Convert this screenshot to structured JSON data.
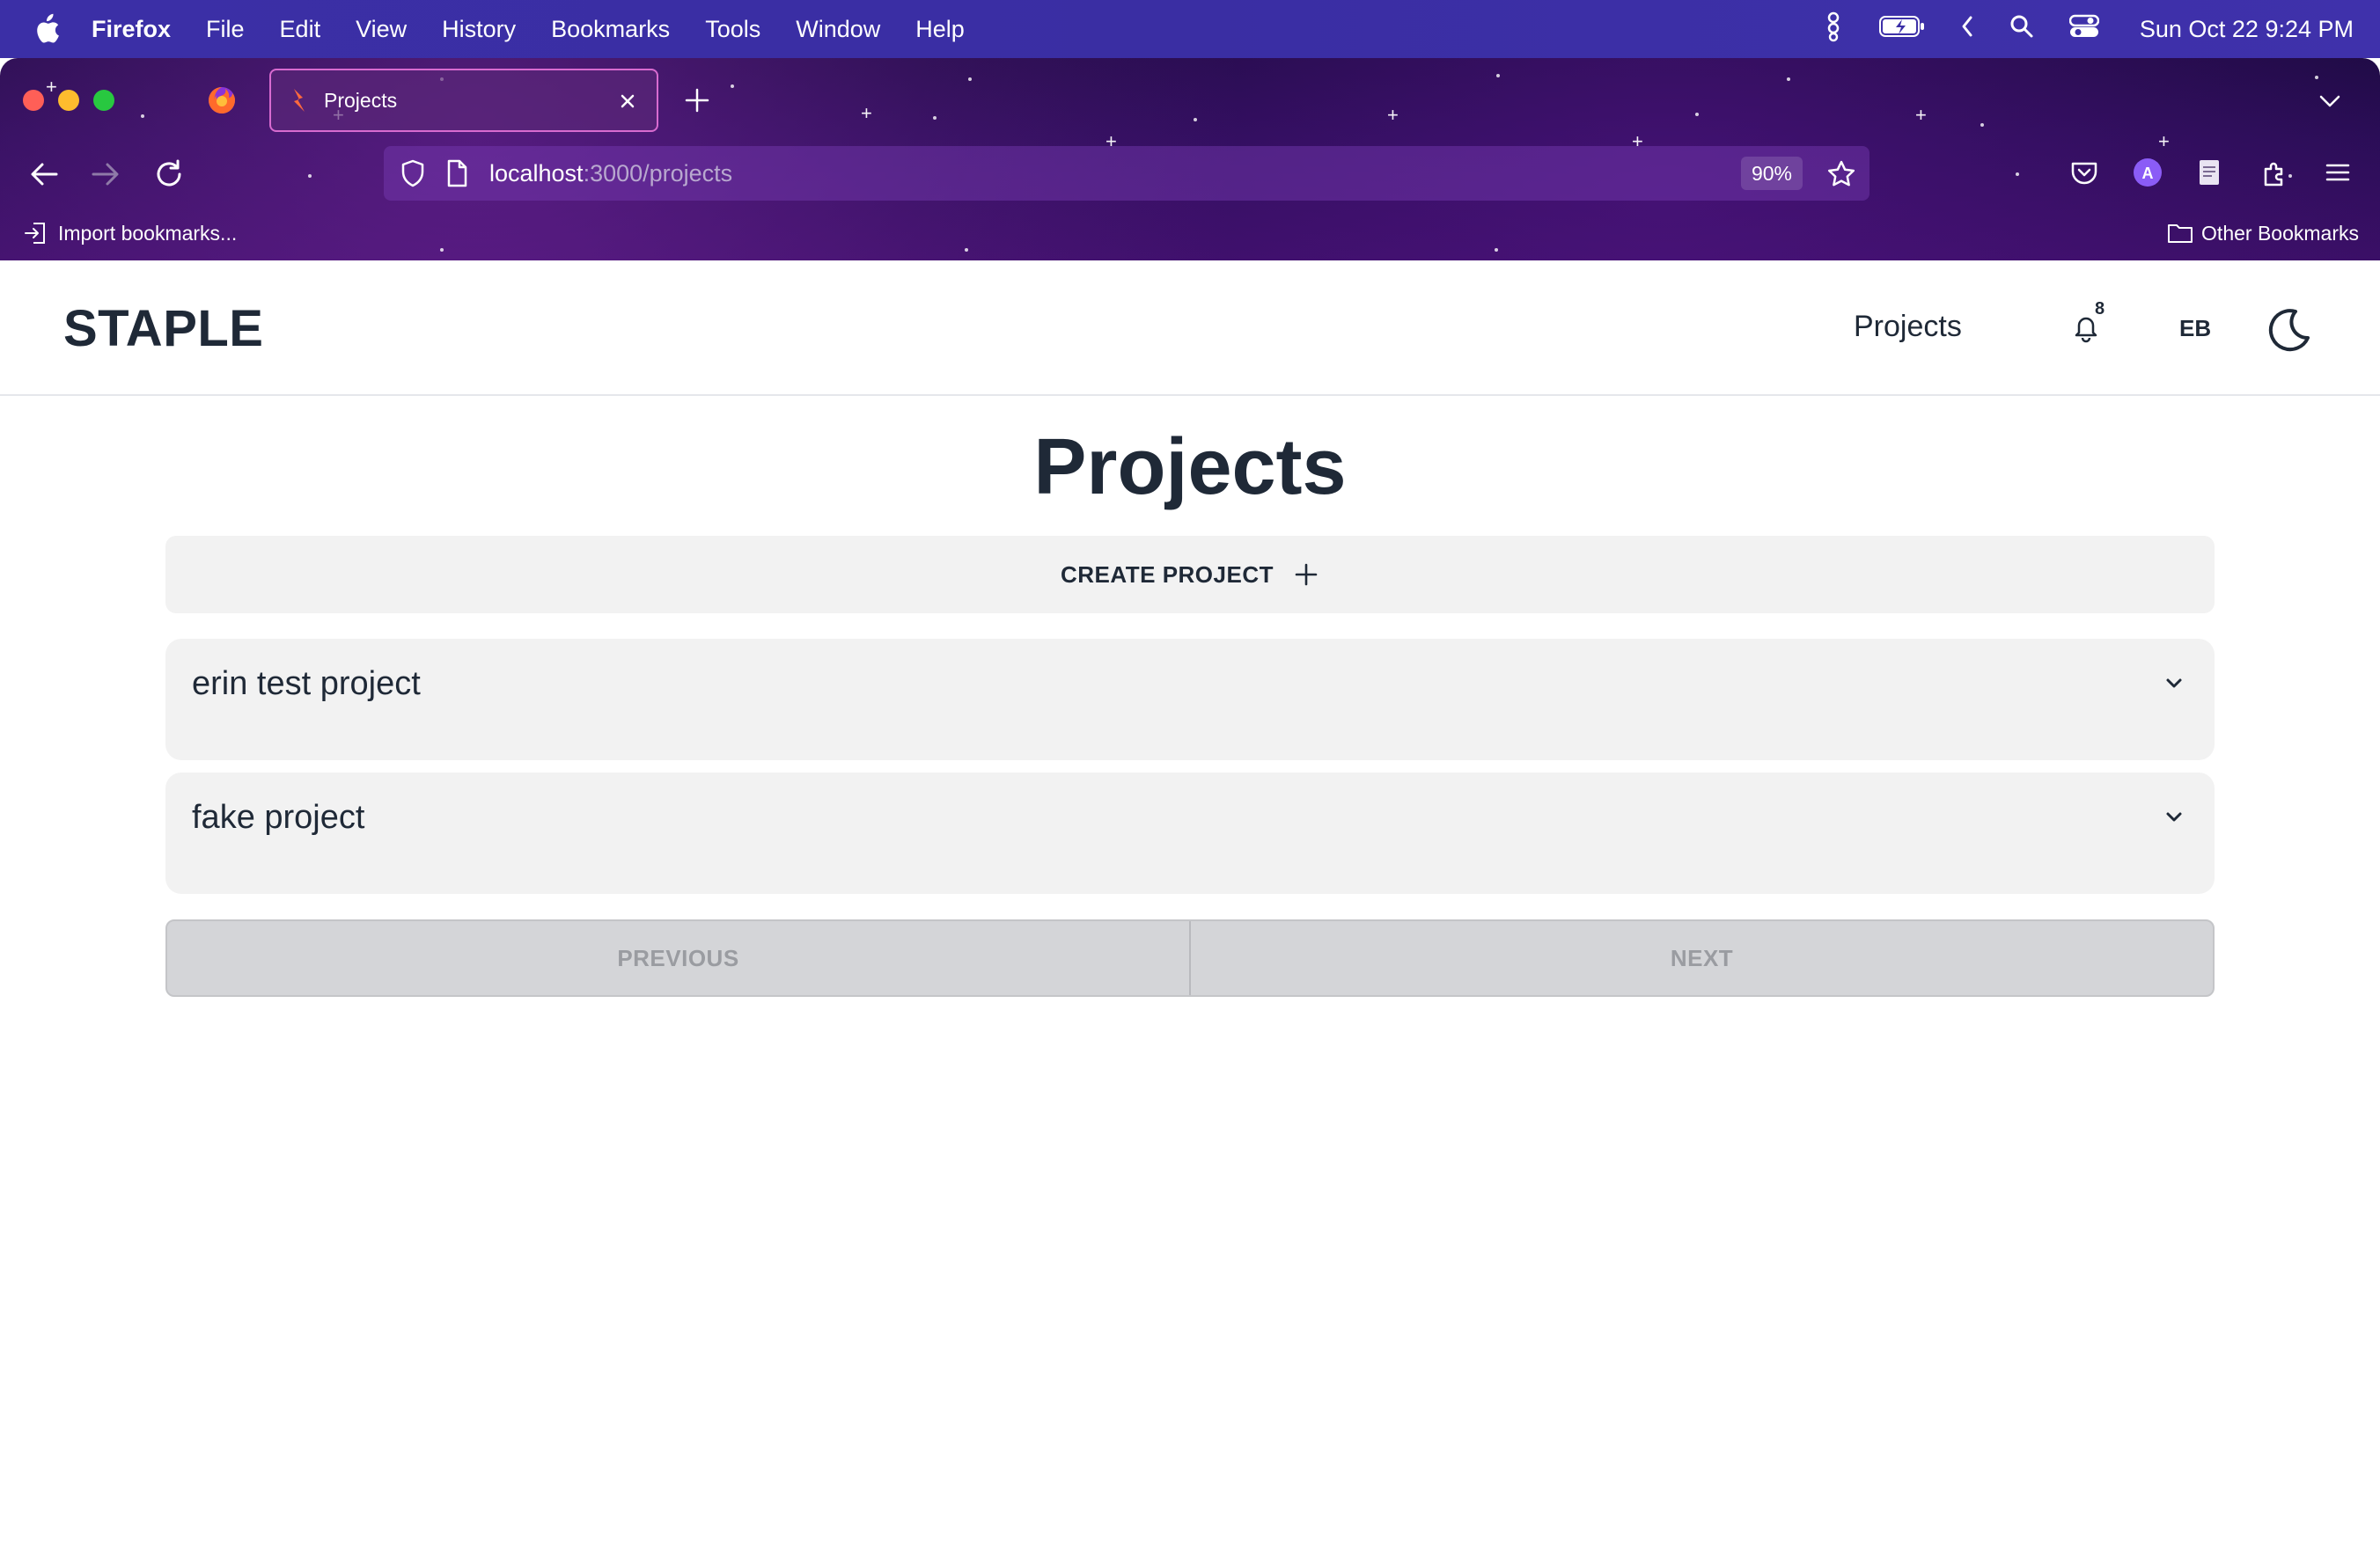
{
  "menubar": {
    "app_name": "Firefox",
    "items": [
      "File",
      "Edit",
      "View",
      "History",
      "Bookmarks",
      "Tools",
      "Window",
      "Help"
    ],
    "clock": "Sun Oct 22  9:24 PM"
  },
  "browser": {
    "tab_title": "Projects",
    "url_host": "localhost",
    "url_path": ":3000/projects",
    "zoom": "90%",
    "bookmarks": {
      "import_label": "Import bookmarks...",
      "other_label": "Other Bookmarks"
    }
  },
  "app": {
    "brand": "STAPLE",
    "nav": {
      "projects_link": "Projects",
      "notification_count": "8",
      "user_initials": "EB"
    },
    "page_title": "Projects",
    "create_button": "CREATE PROJECT",
    "projects": [
      {
        "name": "erin test project"
      },
      {
        "name": "fake project"
      }
    ],
    "pagination": {
      "previous": "PREVIOUS",
      "next": "NEXT"
    }
  },
  "colors": {
    "menubar": "#3b2fa6",
    "chrome": "#2a0d56",
    "tab_border": "#d86bd0",
    "text_dark": "#1f2937",
    "card_bg": "#f2f2f2",
    "disabled_bg": "#d4d5d8"
  }
}
